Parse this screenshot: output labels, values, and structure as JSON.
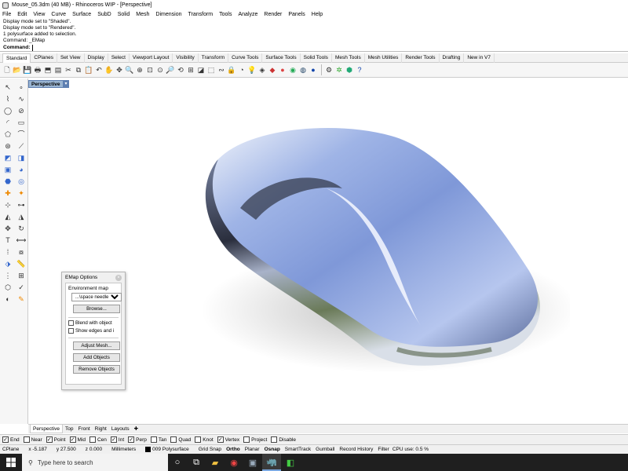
{
  "window": {
    "title": "Mouse_05.3dm (40 MB) - Rhinoceros WIP - [Perspective]"
  },
  "menu": [
    "File",
    "Edit",
    "View",
    "Curve",
    "Surface",
    "SubD",
    "Solid",
    "Mesh",
    "Dimension",
    "Transform",
    "Tools",
    "Analyze",
    "Render",
    "Panels",
    "Help"
  ],
  "command_history": [
    "Display mode set to \"Shaded\".",
    "Display mode set to \"Rendered\".",
    "1 polysurface added to selection.",
    "Command: _EMap"
  ],
  "command_prompt": {
    "label": "Command:",
    "value": ""
  },
  "toolbar_tabs": [
    "Standard",
    "CPlanes",
    "Set View",
    "Display",
    "Select",
    "Viewport Layout",
    "Visibility",
    "Transform",
    "Curve Tools",
    "Surface Tools",
    "Solid Tools",
    "Mesh Tools",
    "Mesh Utilities",
    "Render Tools",
    "Drafting",
    "New in V7"
  ],
  "active_toolbar_tab": "Standard",
  "viewport": {
    "name": "Perspective",
    "dropdown_icon": "chevron-down-icon"
  },
  "emap_panel": {
    "title": "EMap Options",
    "section_label": "Environment map",
    "env_select": "...\\space needle...",
    "browse_label": "Browse...",
    "blend_label": "Blend with object",
    "blend_checked": false,
    "edges_label": "Show edges and i",
    "edges_checked": false,
    "adjust_mesh_label": "Adjust Mesh...",
    "add_objects_label": "Add Objects",
    "remove_objects_label": "Remove Objects"
  },
  "viewport_tabs": [
    "Perspective",
    "Top",
    "Front",
    "Right",
    "Layouts"
  ],
  "add_tab_icon": "plus-icon",
  "osnaps": [
    {
      "label": "End",
      "checked": true
    },
    {
      "label": "Near",
      "checked": false
    },
    {
      "label": "Point",
      "checked": true
    },
    {
      "label": "Mid",
      "checked": true
    },
    {
      "label": "Cen",
      "checked": false
    },
    {
      "label": "Int",
      "checked": true
    },
    {
      "label": "Perp",
      "checked": true
    },
    {
      "label": "Tan",
      "checked": false
    },
    {
      "label": "Quad",
      "checked": false
    },
    {
      "label": "Knot",
      "checked": false
    },
    {
      "label": "Vertex",
      "checked": true
    },
    {
      "label": "Project",
      "checked": false
    },
    {
      "label": "Disable",
      "checked": false
    }
  ],
  "status": {
    "cplane": "CPlane",
    "x": "x -5.187",
    "y": "y 27.500",
    "z": "z 0.000",
    "units": "Millimeters",
    "layer": "009 Polysurface",
    "toggles": [
      "Grid Snap",
      "Ortho",
      "Planar",
      "Osnap",
      "SmartTrack",
      "Gumball",
      "Record History",
      "Filter"
    ],
    "bold_toggles": [
      "Ortho",
      "Osnap"
    ],
    "cpu": "CPU use: 0.5 %"
  },
  "taskbar": {
    "search_placeholder": "Type here to search"
  }
}
